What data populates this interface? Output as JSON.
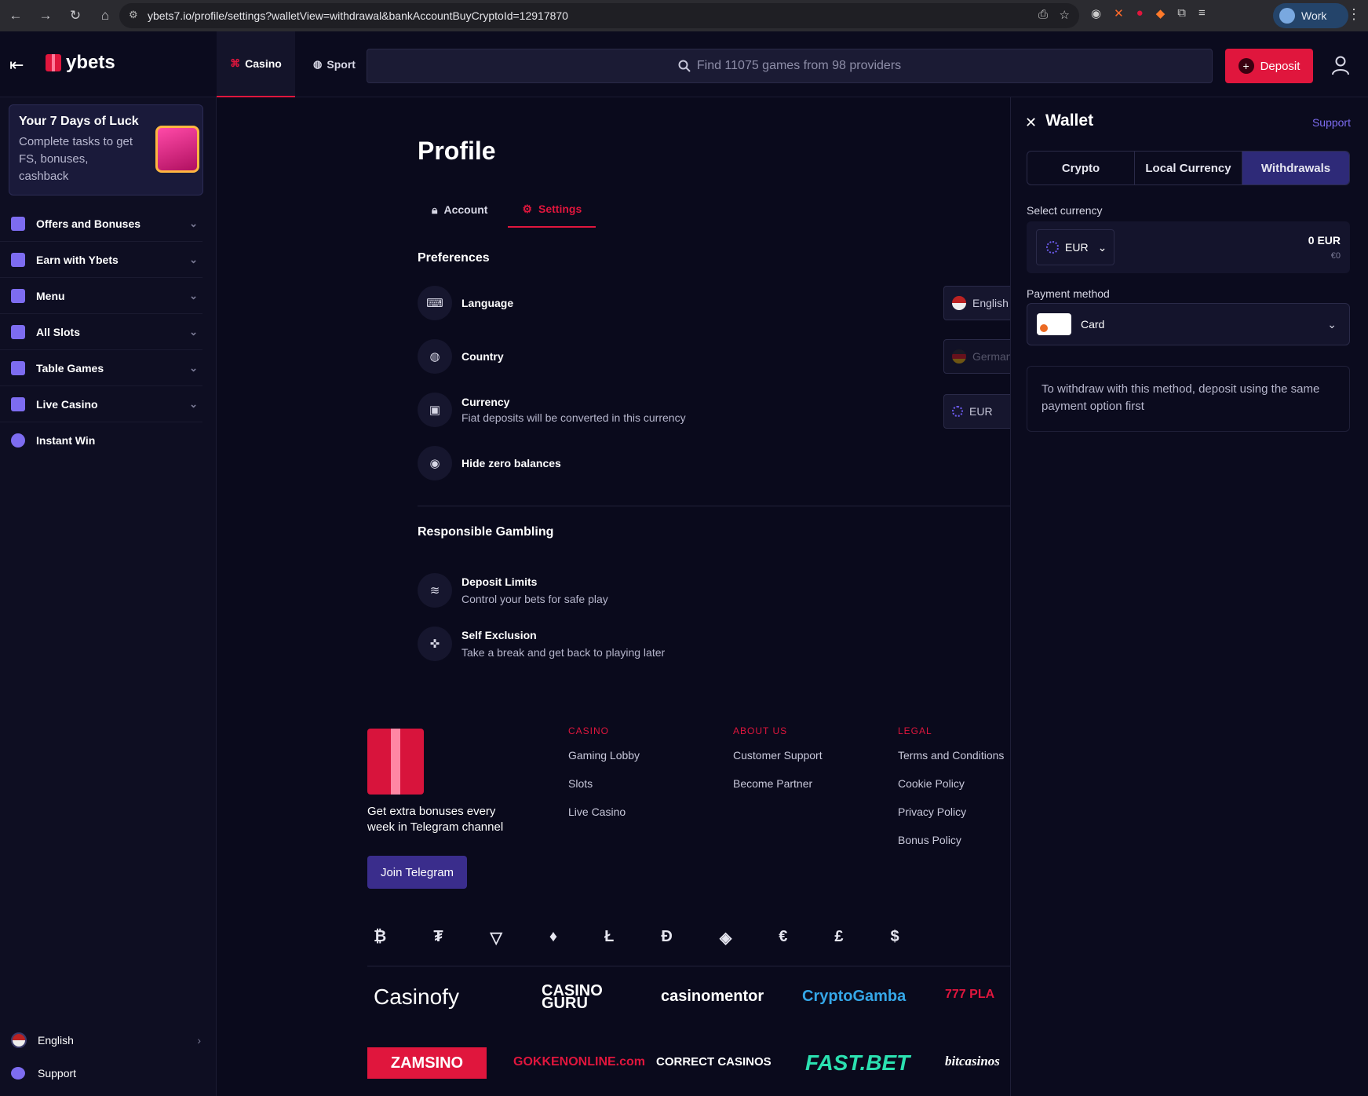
{
  "browser": {
    "url": "ybets7.io/profile/settings?walletView=withdrawal&bankAccountBuyCryptoId=12917870",
    "profile_label": "Work"
  },
  "header": {
    "brand": "ybets",
    "tabs": [
      {
        "label": "Casino"
      },
      {
        "label": "Sport"
      }
    ],
    "search_placeholder": "Find 11075 games from 98 providers",
    "deposit_label": "Deposit"
  },
  "sidebar": {
    "promo_title": "Your 7 Days of Luck",
    "promo_text": "Complete tasks to get FS, bonuses, cashback",
    "items": [
      {
        "label": "Offers and Bonuses",
        "icon": "gift-icon"
      },
      {
        "label": "Earn with Ybets",
        "icon": "coins-icon"
      },
      {
        "label": "Menu",
        "icon": "menu-search-icon"
      },
      {
        "label": "All Slots",
        "icon": "grid-icon"
      },
      {
        "label": "Table Games",
        "icon": "dice-icon"
      },
      {
        "label": "Live Casino",
        "icon": "play-icon"
      },
      {
        "label": "Instant Win",
        "icon": "burst-icon"
      }
    ],
    "language": "English",
    "support": "Support"
  },
  "profile": {
    "title": "Profile",
    "tabs": {
      "account": "Account",
      "settings": "Settings"
    },
    "preferences_heading": "Preferences",
    "language": {
      "label": "Language",
      "value": "English"
    },
    "country": {
      "label": "Country",
      "value": "German"
    },
    "currency": {
      "label": "Currency",
      "sub": "Fiat deposits will be converted in this currency",
      "value": "EUR"
    },
    "hide_zero": {
      "label": "Hide zero balances"
    },
    "responsible_heading": "Responsible Gambling",
    "deposit_limits": {
      "label": "Deposit Limits",
      "sub": "Control your bets for safe play"
    },
    "self_exclusion": {
      "label": "Self Exclusion",
      "sub": "Take a break and get back to playing later"
    }
  },
  "footer": {
    "telegram_text": "Get extra bonuses every week in Telegram channel",
    "telegram_button": "Join Telegram",
    "casino": {
      "heading": "CASINO",
      "links": [
        "Gaming Lobby",
        "Slots",
        "Live Casino"
      ]
    },
    "about": {
      "heading": "ABOUT US",
      "links": [
        "Customer Support",
        "Become Partner"
      ]
    },
    "legal": {
      "heading": "LEGAL",
      "links": [
        "Terms and Conditions",
        "Cookie Policy",
        "Privacy Policy",
        "Bonus Policy"
      ]
    },
    "crypto_symbols": [
      "₿",
      "₮",
      "▽",
      "♦",
      "Ł",
      "Ð",
      "◈",
      "€",
      "£",
      "$"
    ],
    "partners": [
      "Casinofy",
      "CASINO GURU",
      "casinomentor",
      "CryptoGamba",
      "777 PLA",
      "ZAMSINO",
      "GOKKENONLINE.com",
      "CORRECT CASINOS",
      "FAST.BET",
      "bitcasinos"
    ]
  },
  "wallet": {
    "title": "Wallet",
    "support": "Support",
    "tabs": [
      "Crypto",
      "Local Currency",
      "Withdrawals"
    ],
    "select_currency_label": "Select currency",
    "currency": "EUR",
    "amount": "0 EUR",
    "amount_sub": "€0",
    "payment_method_label": "Payment method",
    "payment_method": "Card",
    "note": "To withdraw with this method, deposit using the same payment option first"
  },
  "colors": {
    "accent": "#e0163d",
    "purple": "#7d6cf0",
    "bg": "#0a0a1c"
  }
}
